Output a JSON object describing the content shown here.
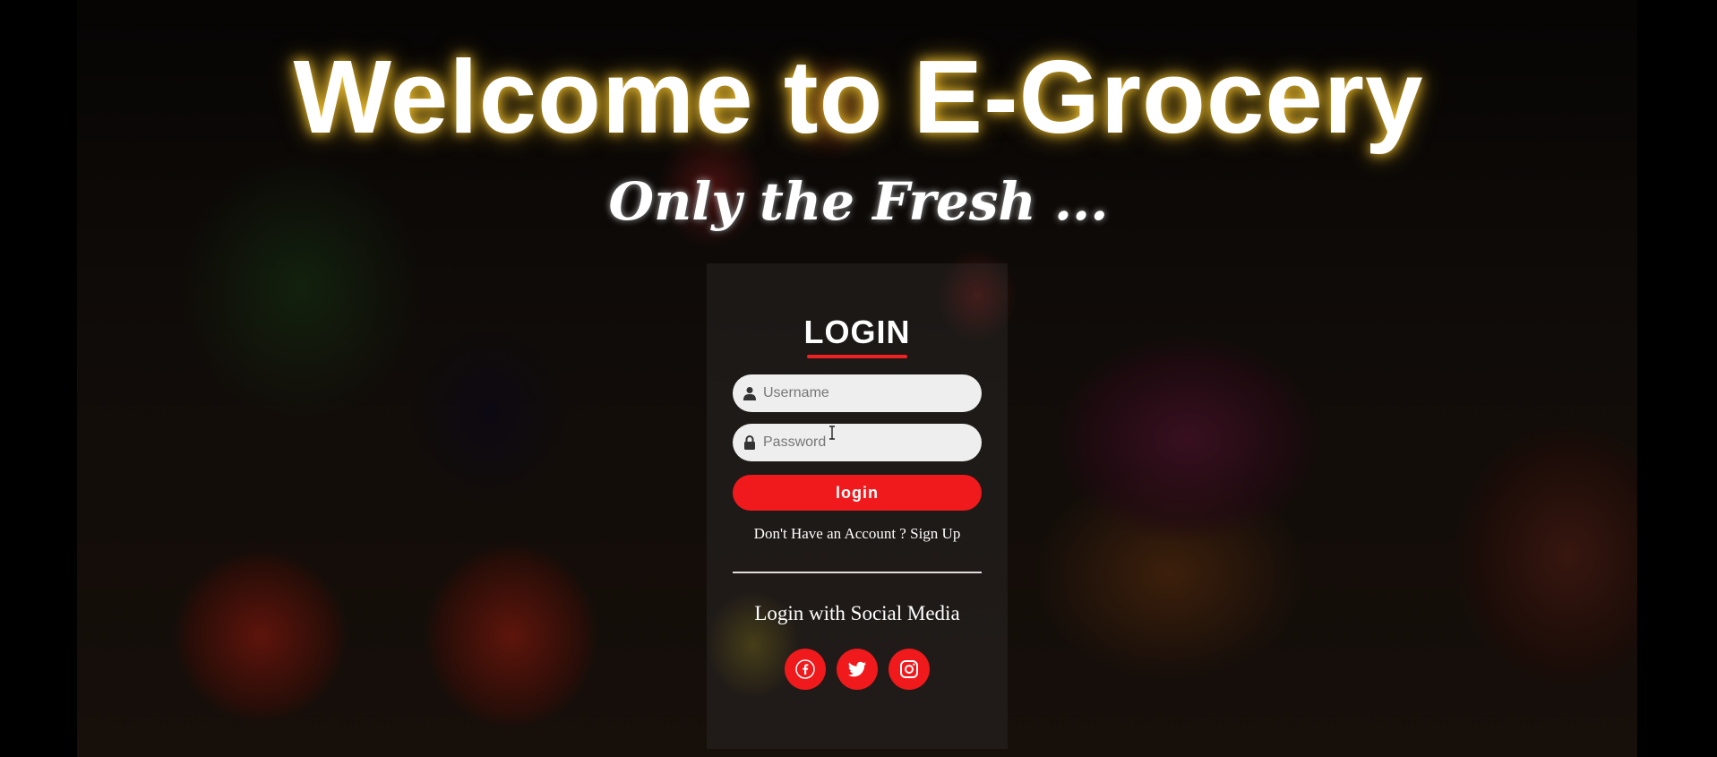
{
  "header": {
    "title": "Welcome to E-Grocery",
    "tagline": "Only the Fresh ..."
  },
  "login": {
    "title": "LOGIN",
    "username_placeholder": "Username",
    "password_placeholder": "Password",
    "button_label": "login",
    "no_account_text": "Don't Have an Account ? ",
    "signup_link": "Sign Up",
    "social_title": "Login with Social Media",
    "social_icons": [
      "facebook-icon",
      "twitter-icon",
      "instagram-icon"
    ]
  },
  "colors": {
    "accent": "#f0191c",
    "glow": "#ffcc33",
    "field_bg": "#eeeeee"
  }
}
